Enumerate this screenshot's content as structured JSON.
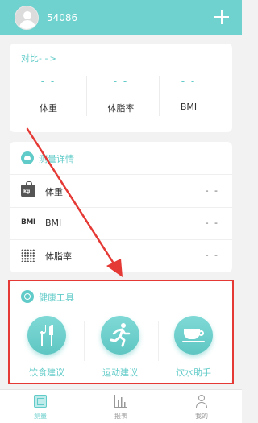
{
  "header": {
    "username": "54086",
    "add_icon": "plus-icon",
    "avatar_icon": "default-avatar-icon"
  },
  "compare": {
    "title": "对比- -",
    "chevron": ">",
    "stats": [
      {
        "value": "- -",
        "label": "体重"
      },
      {
        "value": "- -",
        "label": "体脂率"
      },
      {
        "value": "- -",
        "label": "BMI"
      }
    ]
  },
  "detail": {
    "title": "测量详情",
    "icon": "scale-icon",
    "rows": [
      {
        "label": "体重",
        "value": "- -",
        "icon": "weight-kg-icon",
        "icon_text": "kg"
      },
      {
        "label": "BMI",
        "value": "- -",
        "icon": "bmi-icon",
        "icon_text": "BMI"
      },
      {
        "label": "体脂率",
        "value": "- -",
        "icon": "body-fat-dots-icon"
      }
    ]
  },
  "tools": {
    "title": "健康工具",
    "icon": "gauge-icon",
    "items": [
      {
        "label": "饮食建议",
        "icon": "fork-knife-icon"
      },
      {
        "label": "运动建议",
        "icon": "running-icon"
      },
      {
        "label": "饮水助手",
        "icon": "cup-icon"
      }
    ]
  },
  "nav": {
    "items": [
      {
        "label": "测量",
        "icon": "measure-icon",
        "active": true
      },
      {
        "label": "报表",
        "icon": "report-chart-icon",
        "active": false
      },
      {
        "label": "我的",
        "icon": "profile-icon",
        "active": false
      }
    ]
  },
  "colors": {
    "accent": "#60cbc8",
    "header_bg": "#6fd2cf",
    "annotation_red": "#e53935"
  }
}
